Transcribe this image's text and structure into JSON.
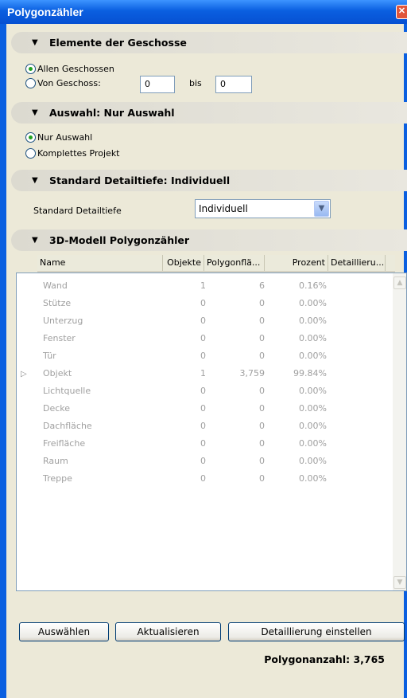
{
  "window": {
    "title": "Polygonzähler",
    "close_glyph": "✕"
  },
  "sections": {
    "elements": {
      "title": "Elemente der Geschosse",
      "arrow": "▼"
    },
    "selection": {
      "title": "Auswahl: Nur Auswahl",
      "arrow": "▼"
    },
    "detail": {
      "title": "Standard Detailtiefe: Individuell",
      "arrow": "▼"
    },
    "counter": {
      "title": "3D-Modell Polygonzähler",
      "arrow": "▼"
    }
  },
  "elements": {
    "all_floors_label": "Allen Geschossen",
    "from_floor_label": "Von Geschoss:",
    "from_value": "0",
    "to_label": "bis",
    "to_value": "0",
    "selected": "all"
  },
  "selection": {
    "only_selection_label": "Nur Auswahl",
    "complete_project_label": "Komplettes Projekt",
    "selected": "only"
  },
  "detail": {
    "label": "Standard Detailtiefe",
    "value": "Individuell",
    "dropdown_icon": "chevron-down-icon"
  },
  "table": {
    "columns": [
      "Name",
      "Objekte",
      "Polygonflä...",
      "Prozent",
      "Detaillieru..."
    ],
    "rows": [
      {
        "name": "Wand",
        "objects": "1",
        "polygons": "6",
        "percent": "0.16%",
        "detail": "",
        "expander": ""
      },
      {
        "name": "Stütze",
        "objects": "0",
        "polygons": "0",
        "percent": "0.00%",
        "detail": "",
        "expander": ""
      },
      {
        "name": "Unterzug",
        "objects": "0",
        "polygons": "0",
        "percent": "0.00%",
        "detail": "",
        "expander": ""
      },
      {
        "name": "Fenster",
        "objects": "0",
        "polygons": "0",
        "percent": "0.00%",
        "detail": "",
        "expander": ""
      },
      {
        "name": "Tür",
        "objects": "0",
        "polygons": "0",
        "percent": "0.00%",
        "detail": "",
        "expander": ""
      },
      {
        "name": "Objekt",
        "objects": "1",
        "polygons": "3,759",
        "percent": "99.84%",
        "detail": "",
        "expander": "▷"
      },
      {
        "name": "Lichtquelle",
        "objects": "0",
        "polygons": "0",
        "percent": "0.00%",
        "detail": "",
        "expander": ""
      },
      {
        "name": "Decke",
        "objects": "0",
        "polygons": "0",
        "percent": "0.00%",
        "detail": "",
        "expander": ""
      },
      {
        "name": "Dachfläche",
        "objects": "0",
        "polygons": "0",
        "percent": "0.00%",
        "detail": "",
        "expander": ""
      },
      {
        "name": "Freifläche",
        "objects": "0",
        "polygons": "0",
        "percent": "0.00%",
        "detail": "",
        "expander": ""
      },
      {
        "name": "Raum",
        "objects": "0",
        "polygons": "0",
        "percent": "0.00%",
        "detail": "",
        "expander": ""
      },
      {
        "name": "Treppe",
        "objects": "0",
        "polygons": "0",
        "percent": "0.00%",
        "detail": "",
        "expander": ""
      }
    ],
    "scroll_up_glyph": "▲",
    "scroll_down_glyph": "▼"
  },
  "buttons": {
    "select": "Auswählen",
    "refresh": "Aktualisieren",
    "set_detail": "Detaillierung einstellen"
  },
  "footer": {
    "total": "Polygonanzahl: 3,765"
  },
  "colors": {
    "titlebar": "#0A5FE0",
    "dialog_bg": "#ECE9D8",
    "radio_dot": "#21A121",
    "disabled_text": "#A0A0A0"
  }
}
